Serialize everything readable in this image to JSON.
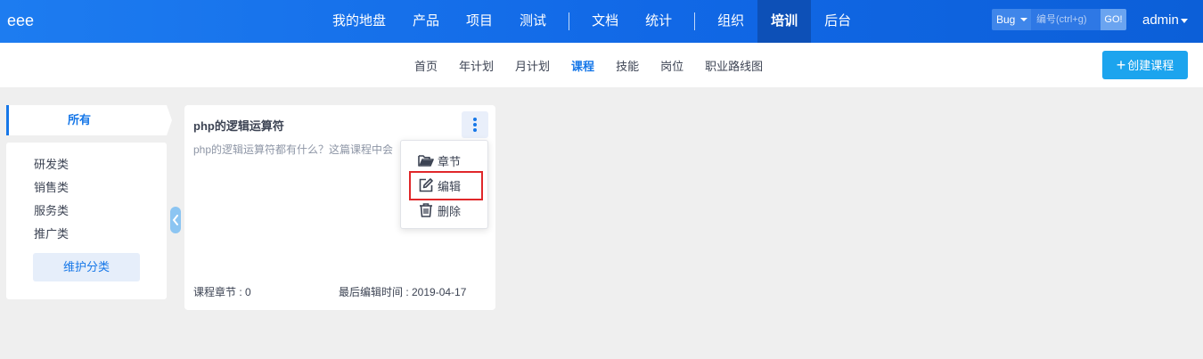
{
  "app": {
    "logo": "eee"
  },
  "topnav": {
    "items": [
      "我的地盘",
      "产品",
      "项目",
      "测试",
      "文档",
      "统计",
      "组织",
      "培训",
      "后台"
    ],
    "active": "培训"
  },
  "search": {
    "type": "Bug",
    "placeholder": "编号(ctrl+g)",
    "go_label": "GO!"
  },
  "user": {
    "name": "admin"
  },
  "subnav": {
    "items": [
      "首页",
      "年计划",
      "月计划",
      "课程",
      "技能",
      "岗位",
      "职业路线图"
    ],
    "active": "课程"
  },
  "create_button": {
    "label": "创建课程",
    "icon": "plus-icon"
  },
  "categories": {
    "all_label": "所有",
    "items": [
      "研发类",
      "销售类",
      "服务类",
      "推广类"
    ],
    "manage_label": "维护分类"
  },
  "course_card": {
    "title": "php的逻辑运算符",
    "description": "php的逻辑运算符都有什么？这篇课程中会",
    "chapters_text": "课程章节 : 0",
    "last_edited_text": "最后编辑时间 : 2019-04-17"
  },
  "card_menu": {
    "items": [
      {
        "label": "章节",
        "icon": "folder-open-icon"
      },
      {
        "label": "编辑",
        "icon": "edit-icon"
      },
      {
        "label": "删除",
        "icon": "trash-icon"
      }
    ],
    "highlighted": "编辑"
  },
  "colors": {
    "topbar": "#1168e6",
    "topbar_active": "#0d50b7",
    "accent": "#1677e8",
    "create_button": "#1ca4ee",
    "highlight_box": "#e0272a",
    "background": "#efefef"
  }
}
